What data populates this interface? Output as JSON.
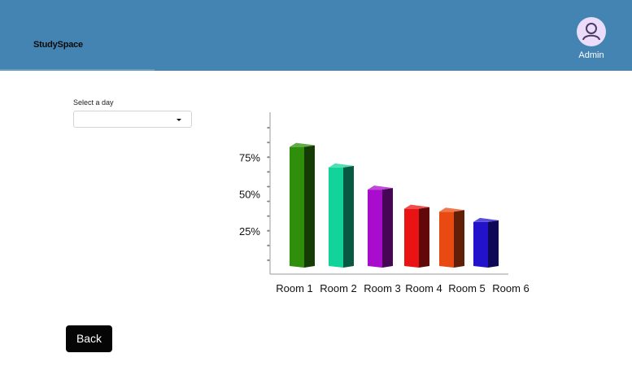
{
  "header": {
    "brand": "StudySpace",
    "user_label": "Admin",
    "icon": "user-avatar-icon",
    "background": "#4484b2"
  },
  "filter": {
    "label": "Select a day",
    "selected_value": ""
  },
  "back_button": {
    "label": "Back"
  },
  "chart_data": {
    "type": "bar",
    "title": "",
    "xlabel": "",
    "ylabel": "",
    "categories": [
      "Room 1",
      "Room 2",
      "Room 3",
      "Room 4",
      "Room 5",
      "Room 6"
    ],
    "values": [
      82,
      68,
      53,
      40,
      38,
      31
    ],
    "y_ticks": [
      "25%",
      "50%",
      "75%"
    ],
    "ylim": [
      0,
      100
    ],
    "grid": false,
    "style": "3d-bar",
    "colors": [
      "#2f8f0a",
      "#12d49a",
      "#a80ccc",
      "#ea1313",
      "#e84a12",
      "#2212cc"
    ]
  }
}
